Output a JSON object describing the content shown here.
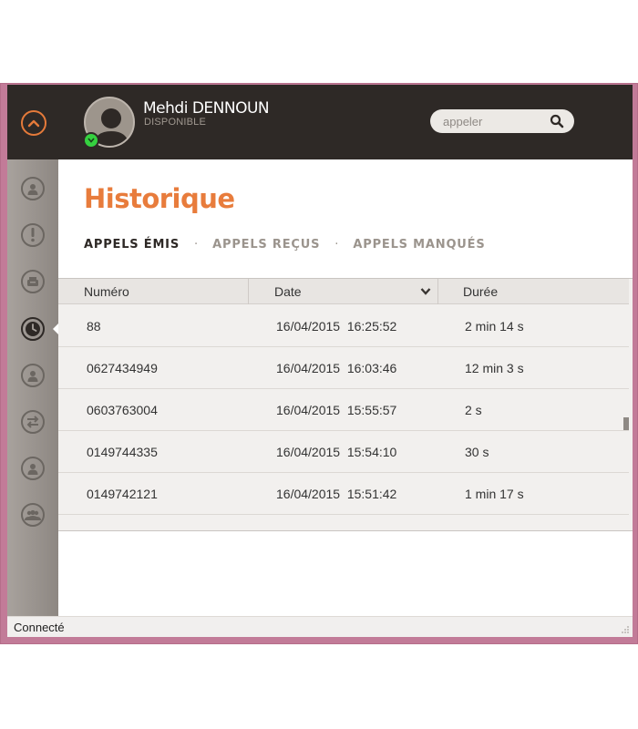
{
  "header": {
    "user_name": "Mehdi DENNOUN",
    "user_status": "DISPONIBLE",
    "search_placeholder": "appeler"
  },
  "colors": {
    "accent": "#e87c3c",
    "topbar": "#2e2926",
    "online": "#35d140",
    "window_frame": "#c27b98"
  },
  "sidebar": {
    "items": [
      {
        "icon": "contact-icon"
      },
      {
        "icon": "alert-icon"
      },
      {
        "icon": "voicemail-icon"
      },
      {
        "icon": "clock-icon",
        "active": true
      },
      {
        "icon": "contact-icon"
      },
      {
        "icon": "transfer-icon"
      },
      {
        "icon": "contact-icon"
      },
      {
        "icon": "group-icon"
      }
    ]
  },
  "main": {
    "title": "Historique",
    "tabs": [
      {
        "label": "APPELS ÉMIS",
        "active": true
      },
      {
        "label": "APPELS REÇUS"
      },
      {
        "label": "APPELS MANQUÉS"
      }
    ],
    "tab_separator": "·"
  },
  "table": {
    "columns": [
      "Numéro",
      "Date",
      "Durée"
    ],
    "rows": [
      {
        "number": "88",
        "date": "16/04/2015  16:25:52",
        "duration": "2 min 14 s"
      },
      {
        "number": "0627434949",
        "date": "16/04/2015  16:03:46",
        "duration": "12 min 3 s"
      },
      {
        "number": "0603763004",
        "date": "16/04/2015  15:55:57",
        "duration": "2 s"
      },
      {
        "number": "0149744335",
        "date": "16/04/2015  15:54:10",
        "duration": "30 s"
      },
      {
        "number": "0149742121",
        "date": "16/04/2015  15:51:42",
        "duration": "1 min 17 s"
      }
    ]
  },
  "statusbar": {
    "text": "Connecté"
  }
}
